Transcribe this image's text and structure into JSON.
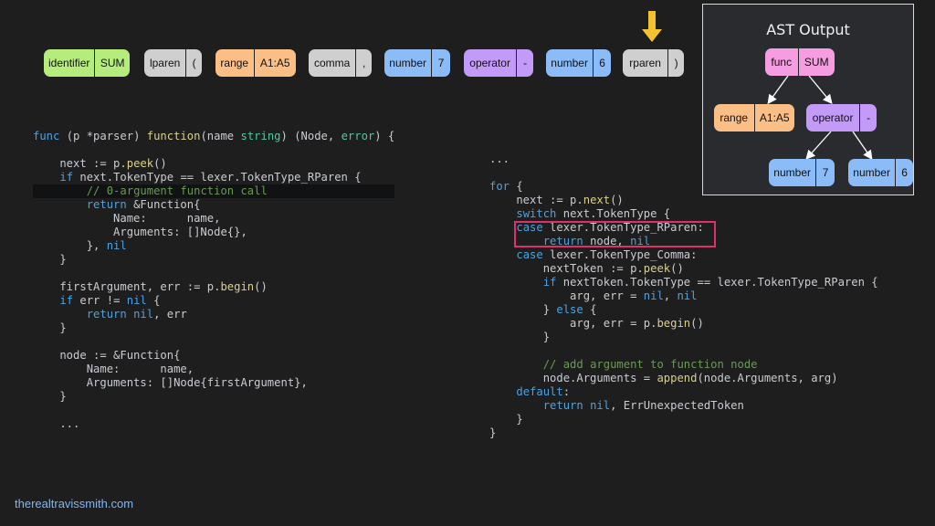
{
  "tokens": [
    {
      "type": "identifier",
      "value": "SUM",
      "color": "#b6ec7c"
    },
    {
      "type": "lparen",
      "value": "(",
      "color": "#cfcfcf"
    },
    {
      "type": "range",
      "value": "A1:A5",
      "color": "#fbbf86"
    },
    {
      "type": "comma",
      "value": ",",
      "color": "#cfcfcf"
    },
    {
      "type": "number",
      "value": "7",
      "color": "#8cbcf7"
    },
    {
      "type": "operator",
      "value": "-",
      "color": "#c39af7"
    },
    {
      "type": "number",
      "value": "6",
      "color": "#8cbcf7"
    },
    {
      "type": "rparen",
      "value": ")",
      "color": "#cfcfcf"
    }
  ],
  "pointer": {
    "icon": "down-arrow-icon",
    "color": "#f2c230",
    "target_token": "rparen"
  },
  "ast": {
    "title": "AST Output",
    "nodes": {
      "func": {
        "type": "func",
        "value": "SUM",
        "color": "#f59de0"
      },
      "range": {
        "type": "range",
        "value": "A1:A5",
        "color": "#fbbf86"
      },
      "operator": {
        "type": "operator",
        "value": "-",
        "color": "#c39af7"
      },
      "num7": {
        "type": "number",
        "value": "7",
        "color": "#8cbcf7"
      },
      "num6": {
        "type": "number",
        "value": "6",
        "color": "#8cbcf7"
      }
    }
  },
  "code_left": [
    "func (p *parser) function(name string) (Node, error) {",
    "",
    "    next := p.peek()",
    "    if next.TokenType == lexer.TokenType_RParen {",
    "        // 0-argument function call",
    "        return &Function{",
    "            Name:      name,",
    "            Arguments: []Node{},",
    "        }, nil",
    "    }",
    "",
    "    firstArgument, err := p.begin()",
    "    if err != nil {",
    "        return nil, err",
    "    }",
    "",
    "    node := &Function{",
    "        Name:      name,",
    "        Arguments: []Node{firstArgument},",
    "    }",
    "",
    "    ..."
  ],
  "code_right": [
    "...",
    "",
    "for {",
    "    next := p.next()",
    "    switch next.TokenType {",
    "    case lexer.TokenType_RParen:",
    "        return node, nil",
    "    case lexer.TokenType_Comma:",
    "        nextToken := p.peek()",
    "        if nextToken.TokenType == lexer.TokenType_RParen {",
    "            arg, err = nil, nil",
    "        } else {",
    "            arg, err = p.begin()",
    "        }",
    "",
    "        // add argument to function node",
    "        node.Arguments = append(node.Arguments, arg)",
    "    default:",
    "        return nil, ErrUnexpectedToken",
    "    }",
    "}"
  ],
  "highlight_color": "#e0306a",
  "credit": "therealtravissmith.com"
}
